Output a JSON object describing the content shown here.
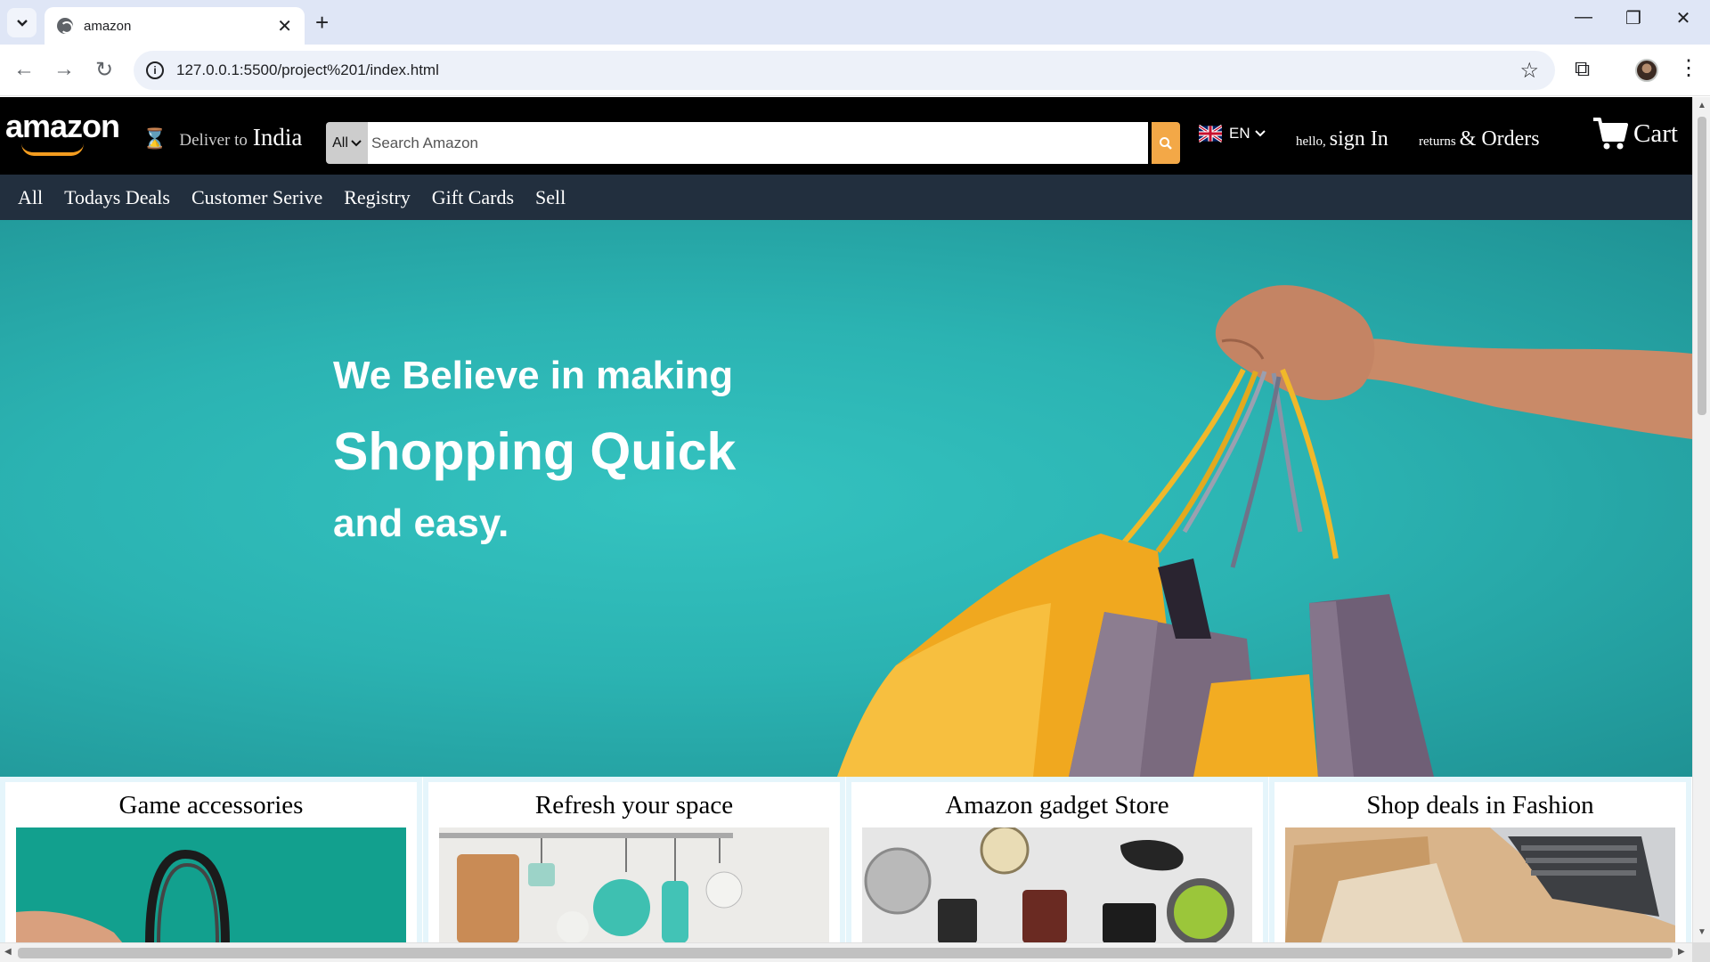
{
  "browser": {
    "tab_title": "amazon",
    "url": "127.0.0.1:5500/project%201/index.html",
    "new_tab_glyph": "+",
    "tab_close_glyph": "✕",
    "window_buttons": [
      "—",
      "❐",
      "✕"
    ]
  },
  "navbar": {
    "logo": "amazon",
    "deliver_label": "Deliver to",
    "deliver_country": "India",
    "search_category": "All",
    "search_placeholder": "Search Amazon",
    "language": "EN",
    "signin_small": "hello,",
    "signin_big": "sign In",
    "orders_small": "returns",
    "orders_big": "& Orders",
    "cart": "Cart"
  },
  "subnav": {
    "items": [
      "All",
      "Todays Deals",
      "Customer Serive",
      "Registry",
      "Gift Cards",
      "Sell"
    ]
  },
  "hero": {
    "line1": "We Believe in making",
    "line2": "Shopping Quick",
    "line3": "and easy."
  },
  "cards": [
    {
      "title": "Game accessories"
    },
    {
      "title": "Refresh your space"
    },
    {
      "title": "Amazon gadget Store"
    },
    {
      "title": "Shop deals in Fashion"
    }
  ],
  "colors": {
    "navbar_bg": "#000000",
    "subnav_bg": "#222f3e",
    "hero_bg": "#2bb3b2",
    "search_button": "#f3a847",
    "card_border": "#e5f5fb"
  },
  "icons": {
    "deliver": "location-pin-icon",
    "search": "search-icon",
    "cart": "cart-icon",
    "flag": "uk-flag-icon"
  }
}
